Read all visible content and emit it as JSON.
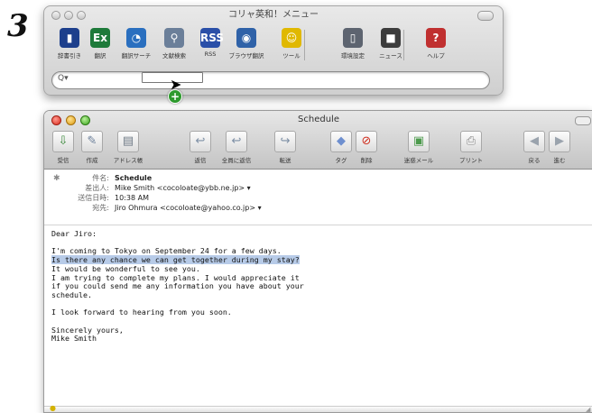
{
  "step": {
    "number": "3"
  },
  "menu_window": {
    "title": "コリャ英和！メニュー",
    "tools": [
      {
        "label": "辞書引き",
        "icon": "dictionary-icon",
        "glyph": "▮",
        "color": "#1d3f8c"
      },
      {
        "label": "翻訳",
        "icon": "excel-translate-icon",
        "glyph": "Ex",
        "color": "#1e7a3a"
      },
      {
        "label": "翻訳サーチ",
        "icon": "globe-search-icon",
        "glyph": "◔",
        "color": "#2a6fbf"
      },
      {
        "label": "文献検索",
        "icon": "magnifier-icon",
        "glyph": "⚲",
        "color": "#6b7f99"
      },
      {
        "label": "RSS",
        "icon": "rss-icon",
        "glyph": "RSS",
        "color": "#2a4fa8"
      },
      {
        "label": "ブラウザ翻訳",
        "icon": "browser-translate-icon",
        "glyph": "◉",
        "color": "#2f62a8"
      },
      {
        "label": "ツール",
        "icon": "smiley-tool-icon",
        "glyph": "☺",
        "color": "#e0b800"
      },
      {
        "label": "環境設定",
        "icon": "phone-settings-icon",
        "glyph": "▯",
        "color": "#5d6470"
      },
      {
        "label": "ニュース",
        "icon": "news-camera-icon",
        "glyph": "■",
        "color": "#3c3c3c"
      },
      {
        "label": "ヘルプ",
        "icon": "help-icon",
        "glyph": "?",
        "color": "#c03030"
      }
    ],
    "search": {
      "placeholder": "",
      "icon": "search-icon"
    }
  },
  "mail_window": {
    "title": "Schedule",
    "toolbar": [
      {
        "label": "受信",
        "icon": "get-mail-icon",
        "glyph": "⇩",
        "color": "#3e8a3e"
      },
      {
        "label": "作成",
        "icon": "compose-icon",
        "glyph": "✎",
        "color": "#6b7f99"
      },
      {
        "label": "アドレス帳",
        "icon": "address-book-icon",
        "glyph": "▤",
        "color": "#6f7a86"
      },
      {
        "label": "返信",
        "icon": "reply-icon",
        "glyph": "↩",
        "color": "#7d8fa5"
      },
      {
        "label": "全員に返信",
        "icon": "reply-all-icon",
        "glyph": "↩",
        "color": "#7d8fa5"
      },
      {
        "label": "転送",
        "icon": "forward-icon",
        "glyph": "↪",
        "color": "#7d8fa5"
      },
      {
        "label": "タグ",
        "icon": "tag-icon",
        "glyph": "◆",
        "color": "#6e8fcf"
      },
      {
        "label": "削除",
        "icon": "delete-icon",
        "glyph": "⊘",
        "color": "#d03020"
      },
      {
        "label": "迷惑メール",
        "icon": "junk-mail-icon",
        "glyph": "▣",
        "color": "#4c9a4c"
      },
      {
        "label": "プリント",
        "icon": "print-icon",
        "glyph": "⎙",
        "color": "#888888"
      },
      {
        "label": "戻る",
        "icon": "back-icon",
        "glyph": "◀",
        "color": "#9aa3ad"
      },
      {
        "label": "進む",
        "icon": "forward-arrow-icon",
        "glyph": "▶",
        "color": "#9aa3ad"
      }
    ],
    "headers": {
      "subject": {
        "key": "件名:",
        "value": "Schedule"
      },
      "from": {
        "key": "差出人:",
        "value": "Mike Smith <cocoloate@ybb.ne.jp> ▾"
      },
      "date": {
        "key": "送信日時:",
        "value": "10:38 AM"
      },
      "to": {
        "key": "宛先:",
        "value": "Jiro Ohmura <cocoloate@yahoo.co.jp> ▾"
      }
    },
    "body": {
      "greeting": "Dear Jiro:",
      "line1": "I'm coming to Tokyo on September 24 for a few days.",
      "line2_highlighted": "Is there any chance we can get together during my stay?",
      "line3": "It would be wonderful to see you.",
      "line4": "I am trying to complete my plans. I would appreciate it",
      "line5": "if you could send me any information you have about your",
      "line6": "schedule.",
      "line7": "I look forward to hearing from you soon.",
      "closing": "Sincerely yours,",
      "signature": "Mike Smith"
    }
  }
}
